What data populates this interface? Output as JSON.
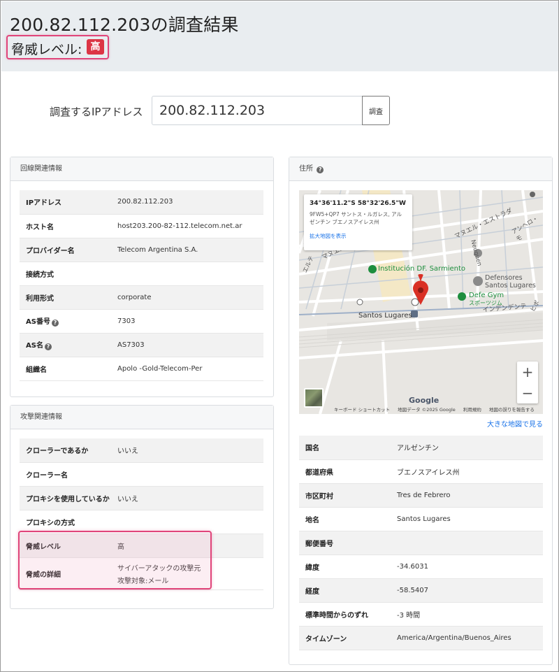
{
  "header": {
    "title": "200.82.112.203の調査結果",
    "threat_label": "脅威レベル:",
    "threat_badge": "高"
  },
  "search": {
    "label": "調査するIPアドレス",
    "value": "200.82.112.203",
    "button_label": "調査"
  },
  "line_card": {
    "title": "回線関連情報",
    "rows": [
      {
        "key": "IPアドレス",
        "value": "200.82.112.203",
        "help": false
      },
      {
        "key": "ホスト名",
        "value": "host203.200-82-112.telecom.net.ar",
        "help": false
      },
      {
        "key": "プロバイダー名",
        "value": "Telecom Argentina S.A.",
        "help": false
      },
      {
        "key": "接続方式",
        "value": "",
        "help": false
      },
      {
        "key": "利用形式",
        "value": "corporate",
        "help": false
      },
      {
        "key": "AS番号",
        "value": "7303",
        "help": true
      },
      {
        "key": "AS名",
        "value": "AS7303",
        "help": true
      },
      {
        "key": "組織名",
        "value": "Apolo -Gold-Telecom-Per",
        "help": false
      }
    ]
  },
  "attack_card": {
    "title": "攻撃関連情報",
    "rows": [
      {
        "key": "クローラーであるか",
        "value": "いいえ"
      },
      {
        "key": "クローラー名",
        "value": ""
      },
      {
        "key": "プロキシを使用しているか",
        "value": "いいえ"
      },
      {
        "key": "プロキシの方式",
        "value": ""
      },
      {
        "key": "脅威レベル",
        "value": "高"
      },
      {
        "key": "脅威の詳細",
        "value": "サイバーアタックの攻撃元",
        "value2": "攻撃対象:メール"
      }
    ]
  },
  "address_card": {
    "title": "住所",
    "map": {
      "coords": "34°36'11.2\"S 58°32'26.5\"W",
      "address": "9FW5+QP7 サントス・ルガレス, アルゼンチン ブエノスアイレス州",
      "enlarge_link": "拡大地図を表示",
      "labels": {
        "place1": "Institución DF. Sarmiento",
        "place2": "Defensores",
        "place2b": "Santos Lugares",
        "place3": "Defe Gym",
        "place3b": "スポーツジム",
        "station": "Santos Lugares",
        "street1": "マヌエル・エストラダ",
        "street2": "マヌエル・ドレゴ",
        "street3": "インデンデンテ",
        "street4": "アンヘロ・モ",
        "street5": "Neuquen",
        "street6": "エルテ",
        "street7": "ヒポ",
        "google": "Google"
      },
      "footer": {
        "shortcuts": "キーボード ショートカット",
        "data": "地図データ ©2025 Google",
        "terms": "利用規約",
        "report": "地図の誤りを報告する"
      },
      "zoom_in": "+",
      "zoom_out": "−"
    },
    "big_map_link": "大きな地図で見る",
    "rows": [
      {
        "key": "国名",
        "value": "アルゼンチン"
      },
      {
        "key": "都道府県",
        "value": "ブエノスアイレス州"
      },
      {
        "key": "市区町村",
        "value": "Tres de Febrero"
      },
      {
        "key": "地名",
        "value": "Santos Lugares"
      },
      {
        "key": "郵便番号",
        "value": ""
      },
      {
        "key": "緯度",
        "value": "-34.6031"
      },
      {
        "key": "経度",
        "value": "-58.5407"
      },
      {
        "key": "標準時間からのずれ",
        "value": "-3 時間"
      },
      {
        "key": "タイムゾーン",
        "value": "America/Argentina/Buenos_Aires"
      }
    ]
  },
  "colors": {
    "header_bg": "#e9edf0",
    "highlight": "#e0457a",
    "badge": "#dc3545",
    "link": "#1a73e8",
    "pin": "#d93025",
    "poi": "#1e8e3e"
  }
}
